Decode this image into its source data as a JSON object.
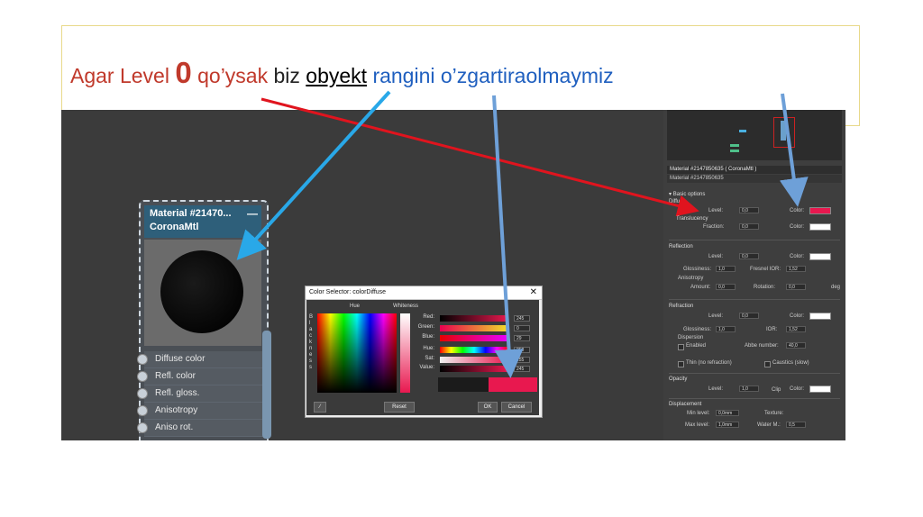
{
  "slide": {
    "title_parts": [
      "Agar Level",
      "0",
      "qo’ysak",
      "biz",
      "obyekt",
      "rangini o’zgartiraolmaymiz"
    ]
  },
  "node": {
    "title_line1": "Material #21470...",
    "title_line2": "CoronaMtl",
    "minimize": "—",
    "slots": [
      "Diffuse color",
      "Refl. color",
      "Refl. gloss.",
      "Anisotropy",
      "Aniso rot."
    ]
  },
  "color_dialog": {
    "title": "Color Selector: colorDiffuse",
    "close": "✕",
    "hue_label": "Hue",
    "whiteness_label": "Whiteness",
    "blackness_label": "Blackness",
    "rows": [
      {
        "name": "Red:",
        "value": "245"
      },
      {
        "name": "Green:",
        "value": "0"
      },
      {
        "name": "Blue:",
        "value": "29"
      },
      {
        "name": "Hue:",
        "value": "250"
      },
      {
        "name": "Sat:",
        "value": "255"
      },
      {
        "name": "Value:",
        "value": "245"
      }
    ],
    "reset_label": "Reset",
    "ok_label": "OK",
    "cancel_label": "Cancel",
    "new_color": "#e8184f"
  },
  "material_panel": {
    "header": "Material #2147850635  ( CoronaMtl )",
    "subheader": "Material #2147850635",
    "basic_options": "Basic options",
    "diffuse": {
      "section": "Diffuse",
      "level_label": "Level:",
      "level_value": "0,0",
      "color_label": "Color:",
      "color": "#e8184f"
    },
    "translucency": {
      "section": "Translucency",
      "fraction_label": "Fraction:",
      "fraction_value": "0,0",
      "color_label": "Color:"
    },
    "reflection": {
      "section": "Reflection",
      "level_label": "Level:",
      "level_value": "0,0",
      "color_label": "Color:",
      "glossiness_label": "Glossiness:",
      "glossiness_value": "1,0",
      "fresnel_label": "Fresnel IOR:",
      "fresnel_value": "1,52",
      "anisotropy_label": "Anisotropy",
      "amount_label": "Amount:",
      "amount_value": "0,0",
      "rotation_label": "Rotation:",
      "rotation_value": "0,0",
      "deg_label": "deg"
    },
    "refraction": {
      "section": "Refraction",
      "level_label": "Level:",
      "level_value": "0,0",
      "color_label": "Color:",
      "glossiness_label": "Glossiness:",
      "glossiness_value": "1,0",
      "ior_label": "IOR:",
      "ior_value": "1,52",
      "dispersion_label": "Dispersion",
      "enabled_label": "Enabled",
      "abbe_label": "Abbe number:",
      "abbe_value": "40,0",
      "thin_label": "Thin (no refraction)",
      "caustics_label": "Caustics (slow)"
    },
    "opacity": {
      "section": "Opacity",
      "level_label": "Level:",
      "level_value": "1,0",
      "clip_label": "Clip",
      "color_label": "Color:"
    },
    "displacement": {
      "section": "Displacement",
      "min_label": "Min level:",
      "min_value": "0,0mm",
      "texture_label": "Texture:",
      "max_label": "Max level:",
      "max_value": "1,0mm",
      "water_label": "Water M.:",
      "water_value": "0,5"
    }
  },
  "colors": {
    "title_red": "#c0392b",
    "title_blue": "#1f5fbf",
    "arrow_red": "#e0141e",
    "arrow_blue": "#29a8e8",
    "arrow_steel": "#6ea0d8"
  }
}
